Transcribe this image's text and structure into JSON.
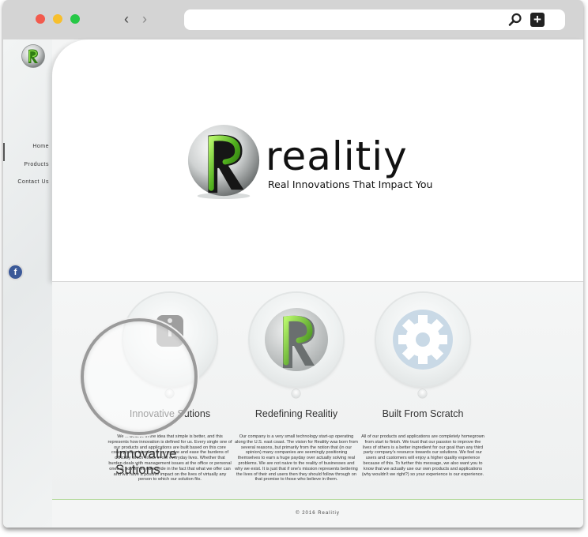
{
  "browser": {
    "back_glyph": "‹",
    "forward_glyph": "›",
    "url": "",
    "icons": [
      "search-icon",
      "new-tab-plus-icon"
    ]
  },
  "sidebar": {
    "items": [
      {
        "label": "Home",
        "active": true
      },
      {
        "label": "Products",
        "active": false
      },
      {
        "label": "Contact Us",
        "active": false
      }
    ],
    "social_icon": "facebook-icon",
    "social_glyph": "f"
  },
  "hero": {
    "brand": "realitiy",
    "tagline": "Real Innovations That Impact You"
  },
  "features": [
    {
      "title": "Innovative Sutions",
      "icon": "info-icon",
      "body": "We ... believe in the idea that simple is better, and this represents how innovation is defined for us. Every single one of our products and applications are built based on this core concept. Our intention is to resolve and ease the burdens of difficulty which exists in our everyday lives. Whether that burden deals with management issues at the office or personal ones at home. We take pride in the fact that what we offer can and will have a positive impact on the lives of virtually any person to which our solution fits."
    },
    {
      "title": "Redefining Realitiy",
      "icon": "realitiy-logo-icon",
      "body": "Our company is a very small technology start-up operating along the U.S. east coast. The vision for Realitiy was born from several reasons, but primarily from the notion that (in our opinion) many companies are seemingly positioning themselves to earn a huge payday over actually solving real problems. We are not naive to the reality of businesses and why we exist. It is just that if one's mission represents bettering the lives of their end users then they should follow through on that promise to those who believe in them."
    },
    {
      "title": "Built From Scratch",
      "icon": "gear-icon",
      "body": "All of our products and applications are completely homegrown from start to finish. We trust that our passion to improve the lives of others is a better ingredient for our goal than any third party company's resource towards our solutions. We feel our users and customers will enjoy a higher quality experience because of this. To further this message, we also want you to know that we actually use our own products and applications (why wouldn't we right?) so your experience is our experience."
    }
  ],
  "footer": {
    "copyright": "© 2016 Realitiy"
  },
  "colors": {
    "accent_green": "#5fb82a",
    "text_dark": "#111111",
    "facebook_blue": "#3b5998"
  }
}
